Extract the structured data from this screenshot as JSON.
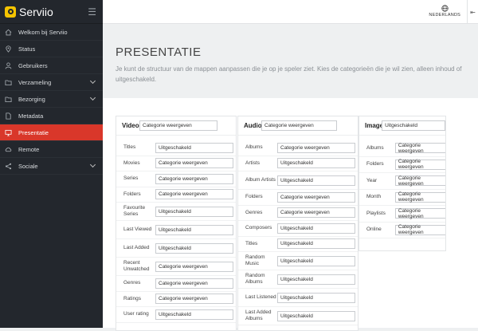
{
  "app": {
    "name": "Serviio"
  },
  "topbar": {
    "language": "NEDERLANDS"
  },
  "sidebar": {
    "items": [
      {
        "label": "Welkom bij Serviio",
        "icon": "home-icon",
        "has_children": false,
        "active": false
      },
      {
        "label": "Status",
        "icon": "location-icon",
        "has_children": false,
        "active": false
      },
      {
        "label": "Gebruikers",
        "icon": "user-icon",
        "has_children": false,
        "active": false
      },
      {
        "label": "Verzameling",
        "icon": "folder-icon",
        "has_children": true,
        "active": false
      },
      {
        "label": "Bezorging",
        "icon": "folder-icon",
        "has_children": true,
        "active": false
      },
      {
        "label": "Metadata",
        "icon": "file-icon",
        "has_children": false,
        "active": false
      },
      {
        "label": "Presentatie",
        "icon": "presentation-icon",
        "has_children": false,
        "active": true
      },
      {
        "label": "Remote",
        "icon": "cloud-icon",
        "has_children": false,
        "active": false
      },
      {
        "label": "Sociale",
        "icon": "share-icon",
        "has_children": true,
        "active": false
      }
    ]
  },
  "page": {
    "title": "PRESENTATIE",
    "description": "Je kunt de structuur van de mappen aanpassen die je op je speler ziet. Kies de categorieën die je wil zien, alleen inhoud of uitgeschakeld."
  },
  "panels": {
    "video": {
      "title": "Video",
      "header_value": "Categorie weergeven",
      "rows": [
        {
          "label": "Titles",
          "value": "Uitgeschakeld"
        },
        {
          "label": "Movies",
          "value": "Categorie weergeven"
        },
        {
          "label": "Series",
          "value": "Categorie weergeven"
        },
        {
          "label": "Folders",
          "value": "Categorie weergeven"
        },
        {
          "label": "Favourite Series",
          "value": "Uitgeschakeld"
        },
        {
          "label": "Last Viewed",
          "value": "Uitgeschakeld"
        },
        {
          "label": "Last Added",
          "value": "Uitgeschakeld"
        },
        {
          "label": "Recent Unwatched",
          "value": "Categorie weergeven"
        },
        {
          "label": "Genres",
          "value": "Categorie weergeven"
        },
        {
          "label": "Ratings",
          "value": "Categorie weergeven"
        },
        {
          "label": "User rating",
          "value": "Uitgeschakeld"
        }
      ]
    },
    "audio": {
      "title": "Audio",
      "header_value": "Categorie weergeven",
      "rows": [
        {
          "label": "Albums",
          "value": "Categorie weergeven"
        },
        {
          "label": "Artists",
          "value": "Uitgeschakeld"
        },
        {
          "label": "Album Artists",
          "value": "Uitgeschakeld"
        },
        {
          "label": "Folders",
          "value": "Categorie weergeven"
        },
        {
          "label": "Genres",
          "value": "Categorie weergeven"
        },
        {
          "label": "Composers",
          "value": "Uitgeschakeld"
        },
        {
          "label": "Titles",
          "value": "Uitgeschakeld"
        },
        {
          "label": "Random Music",
          "value": "Uitgeschakeld"
        },
        {
          "label": "Random Albums",
          "value": "Uitgeschakeld"
        },
        {
          "label": "Last Listened",
          "value": "Uitgeschakeld"
        },
        {
          "label": "Last Added Albums",
          "value": "Uitgeschakeld"
        }
      ]
    },
    "image": {
      "title": "Image",
      "header_value": "Uitgeschakeld",
      "rows": [
        {
          "label": "Albums",
          "value": "Categorie weergeven"
        },
        {
          "label": "Folders",
          "value": "Categorie weergeven"
        },
        {
          "label": "Year",
          "value": "Categorie weergeven"
        },
        {
          "label": "Month",
          "value": "Categorie weergeven"
        },
        {
          "label": "Playlists",
          "value": "Categorie weergeven"
        },
        {
          "label": "Online",
          "value": "Categorie weergeven"
        }
      ]
    }
  },
  "colors": {
    "sidebar_bg": "#23272d",
    "active_item": "#d9372a",
    "brand_logo": "#f5c400"
  }
}
